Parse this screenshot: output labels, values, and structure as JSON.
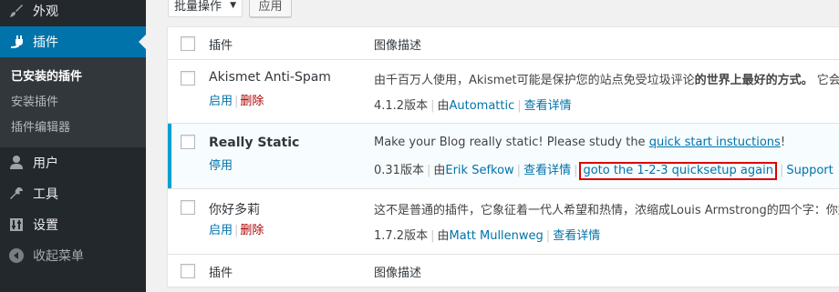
{
  "sidebar": {
    "appearance": "外观",
    "plugins": "插件",
    "submenu": [
      "已安装的插件",
      "安装插件",
      "插件编辑器"
    ],
    "users": "用户",
    "tools": "工具",
    "settings": "设置",
    "collapse": "收起菜单"
  },
  "toolbar": {
    "bulk_action": "批量操作",
    "apply": "应用"
  },
  "table": {
    "col_plugin": "插件",
    "col_desc": "图像描述",
    "plugins": [
      {
        "name": "Akismet Anti-Spam",
        "action1": "启用",
        "action2": "删除",
        "desc_pre": "由千百万人使用，Akismet可能是保护您的站点免受垃圾评论",
        "desc_bold": "的世界上最好的方式。",
        "desc_post": " 它会",
        "version": "4.1.2版本",
        "by": "由",
        "author": "Automattic",
        "details": "查看详情"
      },
      {
        "name": "Really Static",
        "action1": "停用",
        "desc_pre": "Make your Blog really static! Please study the ",
        "desc_link": "quick start instuctions",
        "desc_post": "!",
        "version": "0.31版本",
        "by": "由",
        "author": "Erik Sefkow",
        "details": "查看详情",
        "quicksetup": "goto the 1-2-3 quicksetup again",
        "support": "Support"
      },
      {
        "name": "你好多莉",
        "action1": "启用",
        "action2": "删除",
        "desc_pre": "这不是普通的插件，它象征着一代人希望和热情，浓缩成Louis Armstrong的四个字：你好",
        "version": "1.7.2版本",
        "by": "由",
        "author": "Matt Mullenweg",
        "details": "查看详情"
      }
    ]
  },
  "colors": {
    "sidebar_bg": "#23282d",
    "submenu_bg": "#32373c",
    "accent": "#0073aa",
    "delete": "#a00",
    "active_row_bar": "#00a0d2",
    "highlight_border": "#d00"
  }
}
